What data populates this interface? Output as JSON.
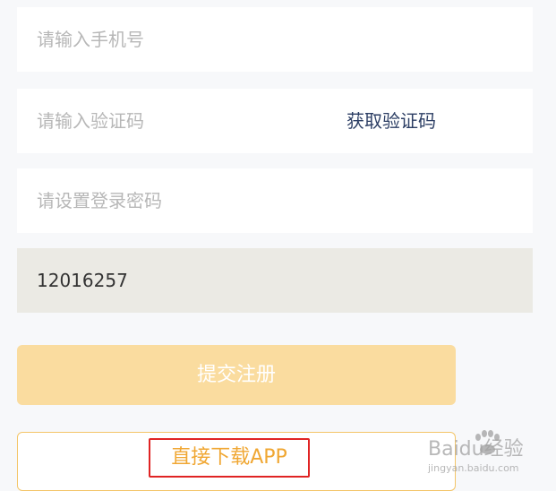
{
  "form": {
    "phone": {
      "placeholder": "请输入手机号",
      "value": ""
    },
    "verification_code": {
      "placeholder": "请输入验证码",
      "value": "",
      "get_code_label": "获取验证码"
    },
    "password": {
      "placeholder": "请设置登录密码",
      "value": ""
    },
    "invite_code": {
      "value": "12016257"
    },
    "submit_label": "提交注册",
    "download_label": "直接下载APP"
  },
  "watermark": {
    "text": "Baidu经验",
    "url": "jingyan.baidu.com"
  },
  "colors": {
    "page_background": "#f7f8fa",
    "input_background": "#ffffff",
    "disabled_input_background": "#ebeae4",
    "placeholder": "#b7b7b7",
    "link": "#2c3e64",
    "submit_background": "#fadc9f",
    "download_border": "#f3c568",
    "download_text": "#f0a733",
    "highlight_box": "#e02424"
  }
}
